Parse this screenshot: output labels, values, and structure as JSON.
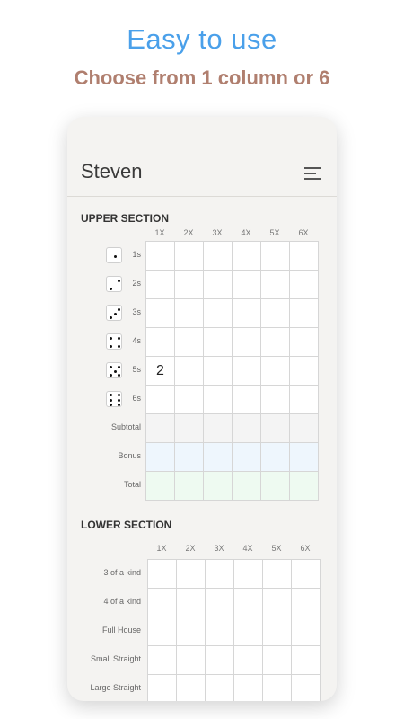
{
  "promo": {
    "headline": "Easy to use",
    "subline": "Choose from 1 column or 6"
  },
  "app": {
    "player_name": "Steven",
    "menu_icon": "menu-icon"
  },
  "columns": [
    "1X",
    "2X",
    "3X",
    "4X",
    "5X",
    "6X"
  ],
  "upper": {
    "title": "UPPER SECTION",
    "rows": [
      {
        "label": "1s",
        "die": 1,
        "values": [
          "",
          "",
          "",
          "",
          "",
          ""
        ]
      },
      {
        "label": "2s",
        "die": 2,
        "values": [
          "",
          "",
          "",
          "",
          "",
          ""
        ]
      },
      {
        "label": "3s",
        "die": 3,
        "values": [
          "",
          "",
          "",
          "",
          "",
          ""
        ]
      },
      {
        "label": "4s",
        "die": 4,
        "values": [
          "",
          "",
          "",
          "",
          "",
          ""
        ]
      },
      {
        "label": "5s",
        "die": 5,
        "values": [
          "2",
          "",
          "",
          "",
          "",
          ""
        ]
      },
      {
        "label": "6s",
        "die": 6,
        "values": [
          "",
          "",
          "",
          "",
          "",
          ""
        ]
      },
      {
        "label": "Subtotal",
        "die": 0,
        "values": [
          "",
          "",
          "",
          "",
          "",
          ""
        ]
      },
      {
        "label": "Bonus",
        "die": 0,
        "values": [
          "",
          "",
          "",
          "",
          "",
          ""
        ]
      },
      {
        "label": "Total",
        "die": 0,
        "values": [
          "",
          "",
          "",
          "",
          "",
          ""
        ]
      }
    ]
  },
  "lower": {
    "title": "LOWER SECTION",
    "rows": [
      {
        "label": "3 of a kind",
        "values": [
          "",
          "",
          "",
          "",
          "",
          ""
        ]
      },
      {
        "label": "4 of a kind",
        "values": [
          "",
          "",
          "",
          "",
          "",
          ""
        ]
      },
      {
        "label": "Full House",
        "values": [
          "",
          "",
          "",
          "",
          "",
          ""
        ]
      },
      {
        "label": "Small Straight",
        "values": [
          "",
          "",
          "",
          "",
          "",
          ""
        ]
      },
      {
        "label": "Large Straight",
        "values": [
          "",
          "",
          "",
          "",
          "",
          ""
        ]
      }
    ]
  },
  "colors": {
    "headline": "#4aa0ea",
    "subline": "#b07f6f",
    "subtotal_bg": "#f4f4f4",
    "bonus_bg": "#eef6fd",
    "total_bg": "#eefaf1"
  }
}
